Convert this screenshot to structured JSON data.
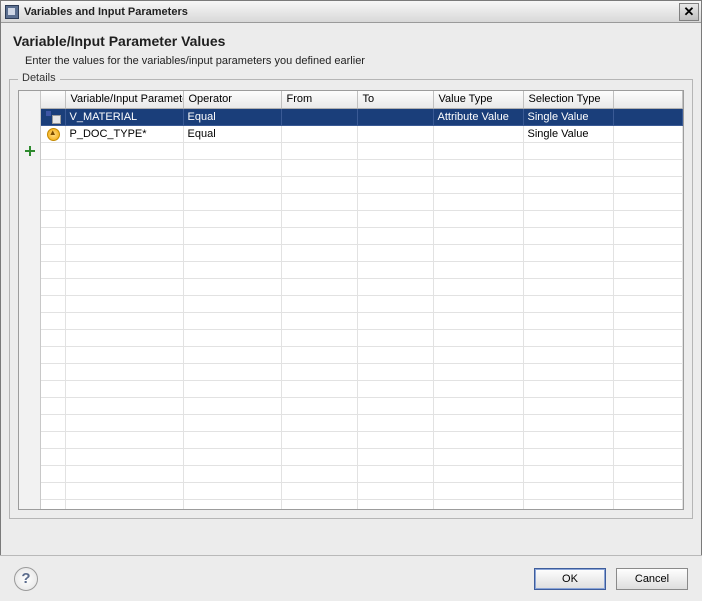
{
  "window": {
    "title": "Variables and Input Parameters",
    "close_glyph": "✕"
  },
  "header": {
    "title": "Variable/Input Parameter Values",
    "subtitle": "Enter the values for the variables/input parameters you defined earlier"
  },
  "group": {
    "legend": "Details"
  },
  "table": {
    "columns": [
      "Variable/Input Parameter",
      "Operator",
      "From",
      "To",
      "Value Type",
      "Selection Type"
    ],
    "rows": [
      {
        "icon": "var",
        "name": "V_MATERIAL",
        "operator": "Equal",
        "from": "",
        "to": "",
        "value_type": "Attribute Value",
        "selection_type": "Single Value",
        "selected": true
      },
      {
        "icon": "param",
        "name": "P_DOC_TYPE*",
        "operator": "Equal",
        "from": "",
        "to": "",
        "value_type": "",
        "selection_type": "Single Value",
        "selected": false
      }
    ],
    "empty_rows": 22
  },
  "footer": {
    "help": "?",
    "ok": "OK",
    "cancel": "Cancel"
  }
}
